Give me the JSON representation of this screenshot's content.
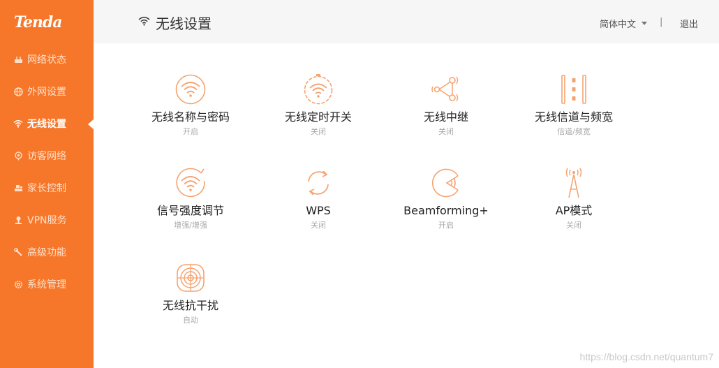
{
  "brand": {
    "logo": "Tenda",
    "accent": "#f6772a"
  },
  "sidebar": {
    "items": [
      {
        "label": "网络状态",
        "icon": "router-icon",
        "active": false
      },
      {
        "label": "外网设置",
        "icon": "globe-icon",
        "active": false
      },
      {
        "label": "无线设置",
        "icon": "wifi-icon",
        "active": true
      },
      {
        "label": "访客网络",
        "icon": "guest-icon",
        "active": false
      },
      {
        "label": "家长控制",
        "icon": "parental-icon",
        "active": false
      },
      {
        "label": "VPN服务",
        "icon": "vpn-icon",
        "active": false
      },
      {
        "label": "高级功能",
        "icon": "wrench-icon",
        "active": false
      },
      {
        "label": "系统管理",
        "icon": "gear-icon",
        "active": false
      }
    ]
  },
  "header": {
    "title": "无线设置",
    "title_icon": "wifi-icon",
    "language": "简体中文",
    "separator": "|",
    "logout": "退出"
  },
  "tiles": [
    {
      "label": "无线名称与密码",
      "status": "开启",
      "icon": "wifi-circle-icon"
    },
    {
      "label": "无线定时开关",
      "status": "关闭",
      "icon": "wifi-timer-icon"
    },
    {
      "label": "无线中继",
      "status": "关闭",
      "icon": "repeater-icon"
    },
    {
      "label": "无线信道与频宽",
      "status": "信道/频宽",
      "icon": "channel-icon"
    },
    {
      "label": "信号强度调节",
      "status": "增强/增强",
      "icon": "signal-strength-icon"
    },
    {
      "label": "WPS",
      "status": "关闭",
      "icon": "wps-icon"
    },
    {
      "label": "Beamforming+",
      "status": "开启",
      "icon": "beamforming-icon"
    },
    {
      "label": "AP模式",
      "status": "关闭",
      "icon": "ap-antenna-icon"
    },
    {
      "label": "无线抗干扰",
      "status": "自动",
      "icon": "anti-interference-icon"
    }
  ],
  "watermark": "https://blog.csdn.net/quantum7"
}
